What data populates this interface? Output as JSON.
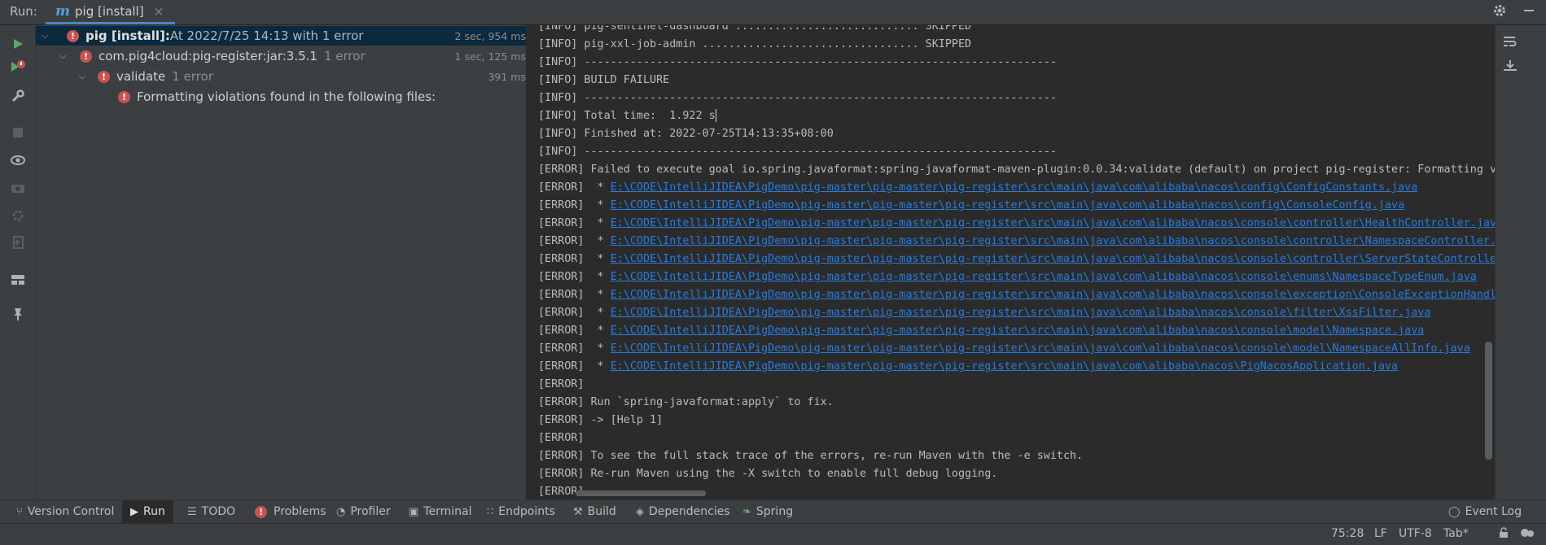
{
  "header": {
    "run_label": "Run:",
    "tab_label": "pig [install]",
    "tab_close": "×"
  },
  "tree": {
    "root": {
      "name": "pig [install]:",
      "detail": " At 2022/7/25 14:13 with 1 error",
      "time": "2 sec, 954 ms"
    },
    "module": {
      "name": "com.pig4cloud:pig-register:jar:3.5.1",
      "detail": "1 error",
      "time": "1 sec, 125 ms"
    },
    "goal": {
      "name": "validate",
      "detail": "1 error",
      "time": "391 ms"
    },
    "message": {
      "text": "Formatting violations found in the following files:"
    }
  },
  "console": {
    "lines": [
      "[INFO] pig-sentinel-dashboard ............................ SKIPPED",
      "[INFO] pig-xxl-job-admin ................................. SKIPPED",
      "[INFO] ------------------------------------------------------------------------",
      "[INFO] BUILD FAILURE",
      "[INFO] ------------------------------------------------------------------------",
      "[INFO] Total time:  1.922 s",
      "[INFO] Finished at: 2022-07-25T14:13:35+08:00",
      "[INFO] ------------------------------------------------------------------------",
      "[ERROR] Failed to execute goal io.spring.javaformat:spring-javaformat-maven-plugin:0.0.34:validate (default) on project pig-register: Formatting vi"
    ],
    "error_prefix": "[ERROR]  * ",
    "files": [
      "E:\\CODE\\IntelliJIDEA\\PigDemo\\pig-master\\pig-master\\pig-register\\src\\main\\java\\com\\alibaba\\nacos\\config\\ConfigConstants.java",
      "E:\\CODE\\IntelliJIDEA\\PigDemo\\pig-master\\pig-master\\pig-register\\src\\main\\java\\com\\alibaba\\nacos\\config\\ConsoleConfig.java",
      "E:\\CODE\\IntelliJIDEA\\PigDemo\\pig-master\\pig-master\\pig-register\\src\\main\\java\\com\\alibaba\\nacos\\console\\controller\\HealthController.java",
      "E:\\CODE\\IntelliJIDEA\\PigDemo\\pig-master\\pig-master\\pig-register\\src\\main\\java\\com\\alibaba\\nacos\\console\\controller\\NamespaceController.j",
      "E:\\CODE\\IntelliJIDEA\\PigDemo\\pig-master\\pig-master\\pig-register\\src\\main\\java\\com\\alibaba\\nacos\\console\\controller\\ServerStateController",
      "E:\\CODE\\IntelliJIDEA\\PigDemo\\pig-master\\pig-master\\pig-register\\src\\main\\java\\com\\alibaba\\nacos\\console\\enums\\NamespaceTypeEnum.java",
      "E:\\CODE\\IntelliJIDEA\\PigDemo\\pig-master\\pig-master\\pig-register\\src\\main\\java\\com\\alibaba\\nacos\\console\\exception\\ConsoleExceptionHandle",
      "E:\\CODE\\IntelliJIDEA\\PigDemo\\pig-master\\pig-master\\pig-register\\src\\main\\java\\com\\alibaba\\nacos\\console\\filter\\XssFilter.java",
      "E:\\CODE\\IntelliJIDEA\\PigDemo\\pig-master\\pig-master\\pig-register\\src\\main\\java\\com\\alibaba\\nacos\\console\\model\\Namespace.java",
      "E:\\CODE\\IntelliJIDEA\\PigDemo\\pig-master\\pig-master\\pig-register\\src\\main\\java\\com\\alibaba\\nacos\\console\\model\\NamespaceAllInfo.java",
      "E:\\CODE\\IntelliJIDEA\\PigDemo\\pig-master\\pig-master\\pig-register\\src\\main\\java\\com\\alibaba\\nacos\\PigNacosApplication.java"
    ],
    "tail": [
      "[ERROR] ",
      "[ERROR] Run `spring-javaformat:apply` to fix.",
      "[ERROR] -> [Help 1]",
      "[ERROR] ",
      "[ERROR] To see the full stack trace of the errors, re-run Maven with the -e switch.",
      "[ERROR] Re-run Maven using the -X switch to enable full debug logging.",
      "[ERROR] "
    ]
  },
  "bottom_tabs": {
    "version_control": "Version Control",
    "run": "Run",
    "todo": "TODO",
    "problems": "Problems",
    "profiler": "Profiler",
    "terminal": "Terminal",
    "endpoints": "Endpoints",
    "build": "Build",
    "dependencies": "Dependencies",
    "spring": "Spring",
    "event_log": "Event Log"
  },
  "status": {
    "position": "75:28",
    "line_sep": "LF",
    "encoding": "UTF-8",
    "indent": "Tab*"
  },
  "colors": {
    "accent": "#4a88c7",
    "error": "#c75450",
    "link": "#287bde",
    "run_green": "#59a869"
  }
}
